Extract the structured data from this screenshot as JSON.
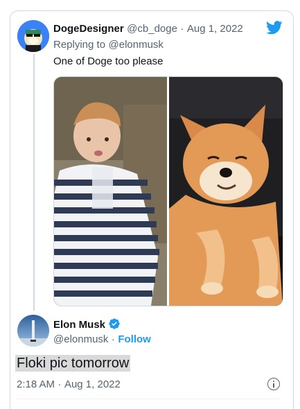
{
  "reply_tweet": {
    "display_name": "DogeDesigner",
    "handle": "@cb_doge",
    "separator": "·",
    "date": "Aug 1, 2022",
    "replying_label": "Replying to",
    "replying_to": "@elonmusk",
    "text": "One of Doge too please",
    "avatar_icon": "doge-avatar",
    "brand_icon": "twitter-bird-icon",
    "brand_color": "#1d9bf0"
  },
  "media": {
    "left_image": "baby-photo",
    "right_image": "shiba-inu-photo"
  },
  "main_tweet": {
    "display_name": "Elon Musk",
    "verified_icon": "verified-badge-icon",
    "handle": "@elonmusk",
    "separator": "·",
    "follow_label": "Follow",
    "text": "Floki pic tomorrow",
    "time": "2:18 AM",
    "date": "Aug 1, 2022",
    "info_icon": "info-icon"
  }
}
